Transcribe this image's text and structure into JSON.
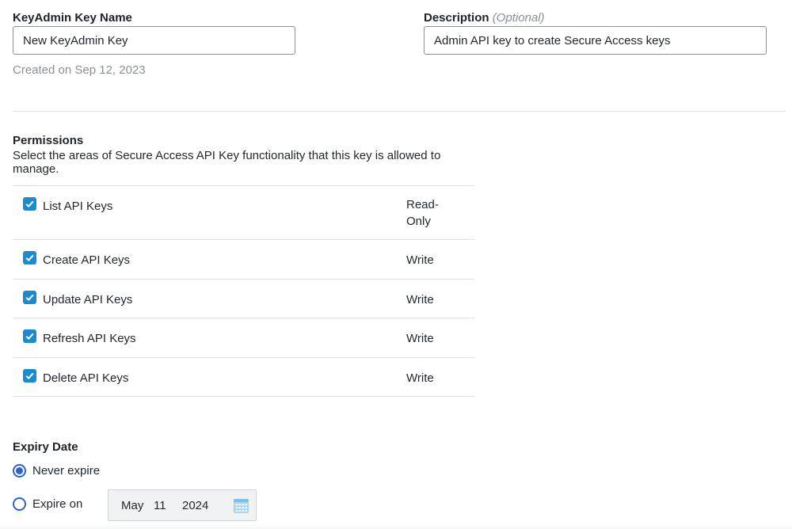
{
  "key_name": {
    "label": "KeyAdmin Key Name",
    "value": "New KeyAdmin Key"
  },
  "description": {
    "label": "Description",
    "optional_label": "(Optional)",
    "value": "Admin API key to create Secure Access keys"
  },
  "created": "Created on Sep 12, 2023",
  "permissions": {
    "title": "Permissions",
    "description": "Select the areas of Secure Access API Key functionality that this key is allowed to manage.",
    "items": [
      {
        "name": "List API Keys",
        "access": "Read-Only",
        "checked": true
      },
      {
        "name": "Create API Keys",
        "access": "Write",
        "checked": true
      },
      {
        "name": "Update API Keys",
        "access": "Write",
        "checked": true
      },
      {
        "name": "Refresh API Keys",
        "access": "Write",
        "checked": true
      },
      {
        "name": "Delete API Keys",
        "access": "Write",
        "checked": true
      }
    ]
  },
  "expiry": {
    "title": "Expiry Date",
    "never_label": "Never expire",
    "expire_on_label": "Expire on",
    "selected": "never",
    "date": {
      "month": "May",
      "day": "11",
      "year": "2024"
    },
    "calendar_icon": "calendar-icon"
  },
  "colors": {
    "checkbox": "#1b8bd0",
    "radio": "#2b64cf",
    "divider": "#dfe1e4"
  }
}
